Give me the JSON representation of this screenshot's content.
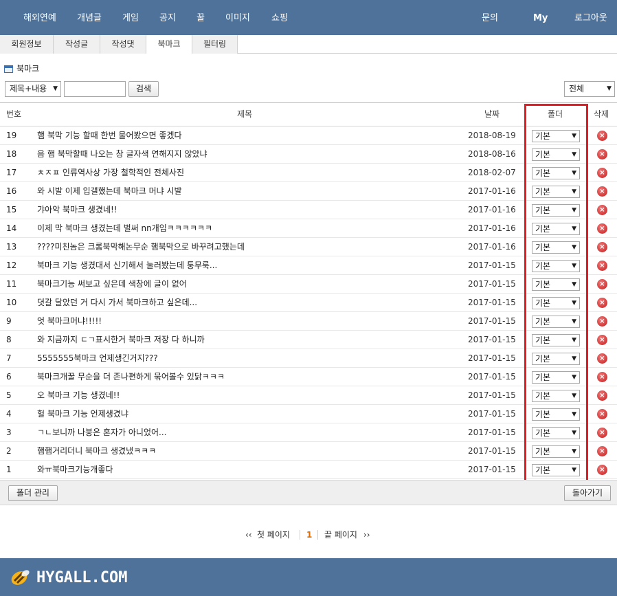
{
  "topnav": {
    "left_items": [
      "해외연예",
      "개념글",
      "게임",
      "공지",
      "꿀",
      "이미지",
      "쇼핑"
    ],
    "right_items": [
      "문의",
      "My",
      "로그아웃"
    ]
  },
  "subtabs": [
    "회원정보",
    "작성글",
    "작성댓",
    "북마크",
    "필터링"
  ],
  "active_subtab": "북마크",
  "page_title": "북마크",
  "search": {
    "type_value": "제목+내용",
    "input_value": "",
    "button_label": "검색",
    "folder_filter_value": "전체"
  },
  "table": {
    "headers": {
      "num": "번호",
      "title": "제목",
      "date": "날짜",
      "folder": "폴더",
      "delete": "삭제"
    },
    "rows": [
      {
        "num": "19",
        "title": "햄 북막 기능 할때 한번 물어봤으면 좋겠다",
        "date": "2018-08-19",
        "folder": "기본"
      },
      {
        "num": "18",
        "title": "음 햄 북막할때 나오는 창 글자색 연해지지 않았냐",
        "date": "2018-08-16",
        "folder": "기본"
      },
      {
        "num": "17",
        "title": "ㅊㅈㅍ 인류역사상 가장 철학적인 전체사진",
        "date": "2018-02-07",
        "folder": "기본"
      },
      {
        "num": "16",
        "title": "와 시발 이제 입갤했는데 북마크 머냐 시발",
        "date": "2017-01-16",
        "folder": "기본"
      },
      {
        "num": "15",
        "title": "갸아악 북마크 생겼네!!",
        "date": "2017-01-16",
        "folder": "기본"
      },
      {
        "num": "14",
        "title": "이제 막 북마크 생겼는데 벌써 nn개임ㅋㅋㅋㅋㅋㅋ",
        "date": "2017-01-16",
        "folder": "기본"
      },
      {
        "num": "13",
        "title": "????미친놈은 크롬북막해논무순 햄북막으로 바꾸려고했는데",
        "date": "2017-01-16",
        "folder": "기본"
      },
      {
        "num": "12",
        "title": "북마크 기능 생겼대서 신기해서 눌러봤는데 퉁무룩...",
        "date": "2017-01-15",
        "folder": "기본"
      },
      {
        "num": "11",
        "title": "북마크기능 써보고 싶은데 색창에 글이 없어",
        "date": "2017-01-15",
        "folder": "기본"
      },
      {
        "num": "10",
        "title": "뎟갈 달았던 거 다시 가서 북마크하고 싶은데...",
        "date": "2017-01-15",
        "folder": "기본"
      },
      {
        "num": "9",
        "title": "엇 북마크머냐!!!!!",
        "date": "2017-01-15",
        "folder": "기본"
      },
      {
        "num": "8",
        "title": "와 지금까지 ㄷㄱ표시한거 북마크 저장 다 하니까",
        "date": "2017-01-15",
        "folder": "기본"
      },
      {
        "num": "7",
        "title": "5555555북마크 언제생긴거지???",
        "date": "2017-01-15",
        "folder": "기본"
      },
      {
        "num": "6",
        "title": "북마크개꿀 무순을 더 존나편하게 묶어볼수 있닭ㅋㅋㅋ",
        "date": "2017-01-15",
        "folder": "기본"
      },
      {
        "num": "5",
        "title": "오 북마크 기능 생겼네!!",
        "date": "2017-01-15",
        "folder": "기본"
      },
      {
        "num": "4",
        "title": "헐 북마크 기능 언제생겼냐",
        "date": "2017-01-15",
        "folder": "기본"
      },
      {
        "num": "3",
        "title": "ㄱㄴ보니까 나붕은 혼자가 아니었어...",
        "date": "2017-01-15",
        "folder": "기본"
      },
      {
        "num": "2",
        "title": "햄햄거리더니 북마크 생겼냈ㅋㅋㅋ",
        "date": "2017-01-15",
        "folder": "기본"
      },
      {
        "num": "1",
        "title": "와ㅠ북마크기능개좋다",
        "date": "2017-01-15",
        "folder": "기본"
      }
    ]
  },
  "actions": {
    "manage_folder": "폴더 관리",
    "back": "돌아가기"
  },
  "pager": {
    "first": "첫 페이지",
    "current": "1",
    "last": "끝 페이지",
    "prev_glyph": "‹‹",
    "next_glyph": "››"
  },
  "footer": {
    "logo_text": "HYGALL.COM"
  },
  "colors": {
    "nav_bg": "#4f729a",
    "highlight": "#e31b23",
    "current_page": "#e06b00"
  }
}
